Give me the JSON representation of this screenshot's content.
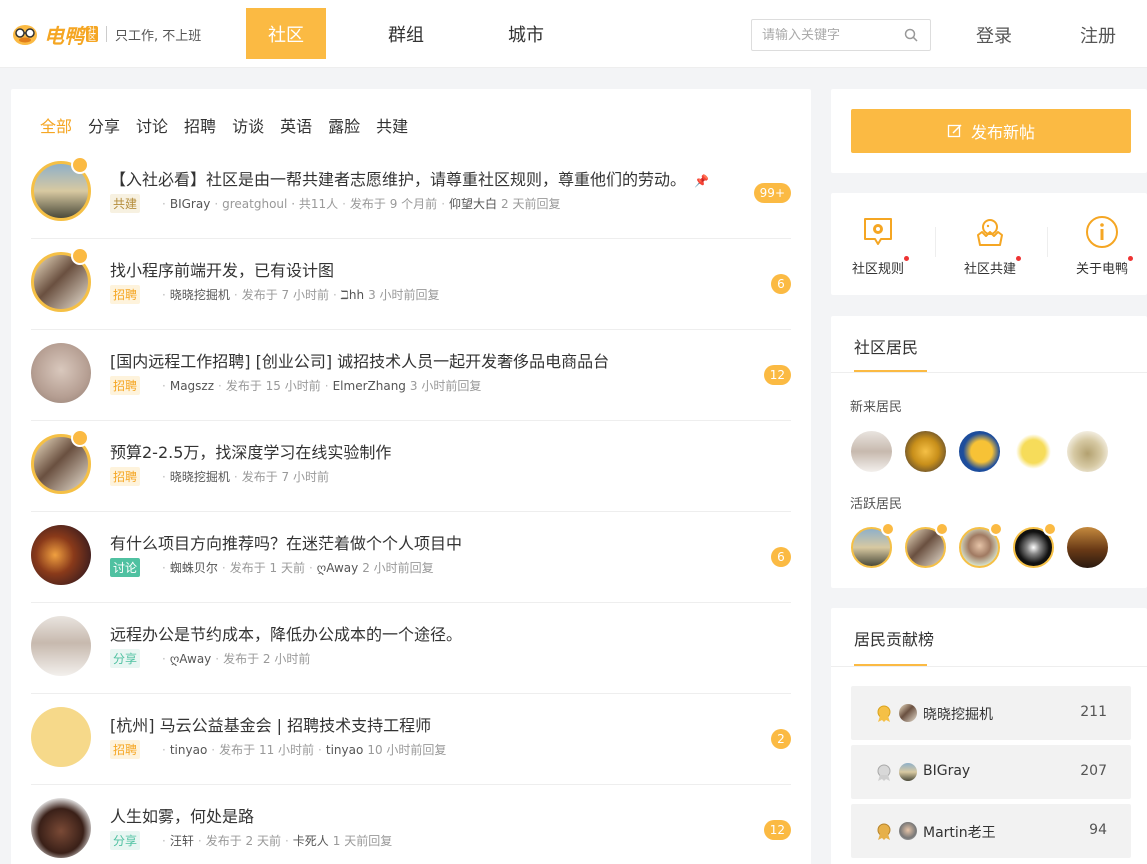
{
  "header": {
    "logo_text": "电鸭",
    "logo_badge": "社区",
    "slogan": "只工作, 不上班",
    "nav": [
      "社区",
      "群组",
      "城市"
    ],
    "search_placeholder": "请输入关键字",
    "login": "登录",
    "register": "注册"
  },
  "tabs": [
    "全部",
    "分享",
    "讨论",
    "招聘",
    "访谈",
    "英语",
    "露脸",
    "共建"
  ],
  "posts": [
    {
      "title": "【入社必看】社区是由一帮共建者志愿维护，请尊重社区规则，尊重他们的劳动。",
      "tag": "共建",
      "author": "BIGray",
      "extra": "greatghoul · 共11人",
      "time": "发布于 9 个月前",
      "replier": "仰望大白",
      "reply_time": "2 天前回复",
      "count": "99+"
    },
    {
      "title": "找小程序前端开发，已有设计图",
      "tag": "招聘",
      "author": "晓晓挖掘机",
      "time": "发布于 7 小时前",
      "replier": "ℶhh",
      "reply_time": "3 小时前回复",
      "count": "6"
    },
    {
      "title": "[国内远程工作招聘] [创业公司] 诚招技术人员一起开发奢侈品电商品台",
      "tag": "招聘",
      "author": "Magszz",
      "time": "发布于 15 小时前",
      "replier": "ElmerZhang",
      "reply_time": "3 小时前回复",
      "count": "12"
    },
    {
      "title": "预算2-2.5万，找深度学习在线实验制作",
      "tag": "招聘",
      "author": "晓晓挖掘机",
      "time": "发布于 7 小时前",
      "replier": "",
      "reply_time": "",
      "count": ""
    },
    {
      "title": "有什么项目方向推荐吗？在迷茫着做个个人项目中",
      "tag": "讨论",
      "author": "蜘蛛贝尔",
      "time": "发布于 1 天前",
      "replier": "ღAway",
      "reply_time": "2 小时前回复",
      "count": "6"
    },
    {
      "title": "远程办公是节约成本，降低办公成本的一个途径。",
      "tag": "分享",
      "author": "ღAway",
      "time": "发布于 2 小时前",
      "replier": "",
      "reply_time": "",
      "count": ""
    },
    {
      "title": "[杭州] 马云公益基金会 | 招聘技术支持工程师",
      "tag": "招聘",
      "author": "tinyao",
      "time": "发布于 11 小时前",
      "replier": "tinyao",
      "reply_time": "10 小时前回复",
      "count": "2"
    },
    {
      "title": "人生如雾，何处是路",
      "tag": "分享",
      "author": "汪轩",
      "time": "发布于 2 天前",
      "replier": "卡死人",
      "reply_time": "1 天前回复",
      "count": "12"
    }
  ],
  "sidebar": {
    "post_button": "发布新帖",
    "quick_links": [
      "社区规则",
      "社区共建",
      "关于电鸭"
    ],
    "residents_title": "社区居民",
    "new_residents": "新来居民",
    "active_residents": "活跃居民",
    "rank_title": "居民贡献榜",
    "rank": [
      {
        "name": "晓晓挖掘机",
        "score": "211"
      },
      {
        "name": "BIGray",
        "score": "207"
      },
      {
        "name": "Martin老王",
        "score": "94"
      }
    ]
  },
  "colors": {
    "accent": "#fbba43",
    "tag_recruit": "#f5a623",
    "tag_share": "#4fc1a1"
  }
}
